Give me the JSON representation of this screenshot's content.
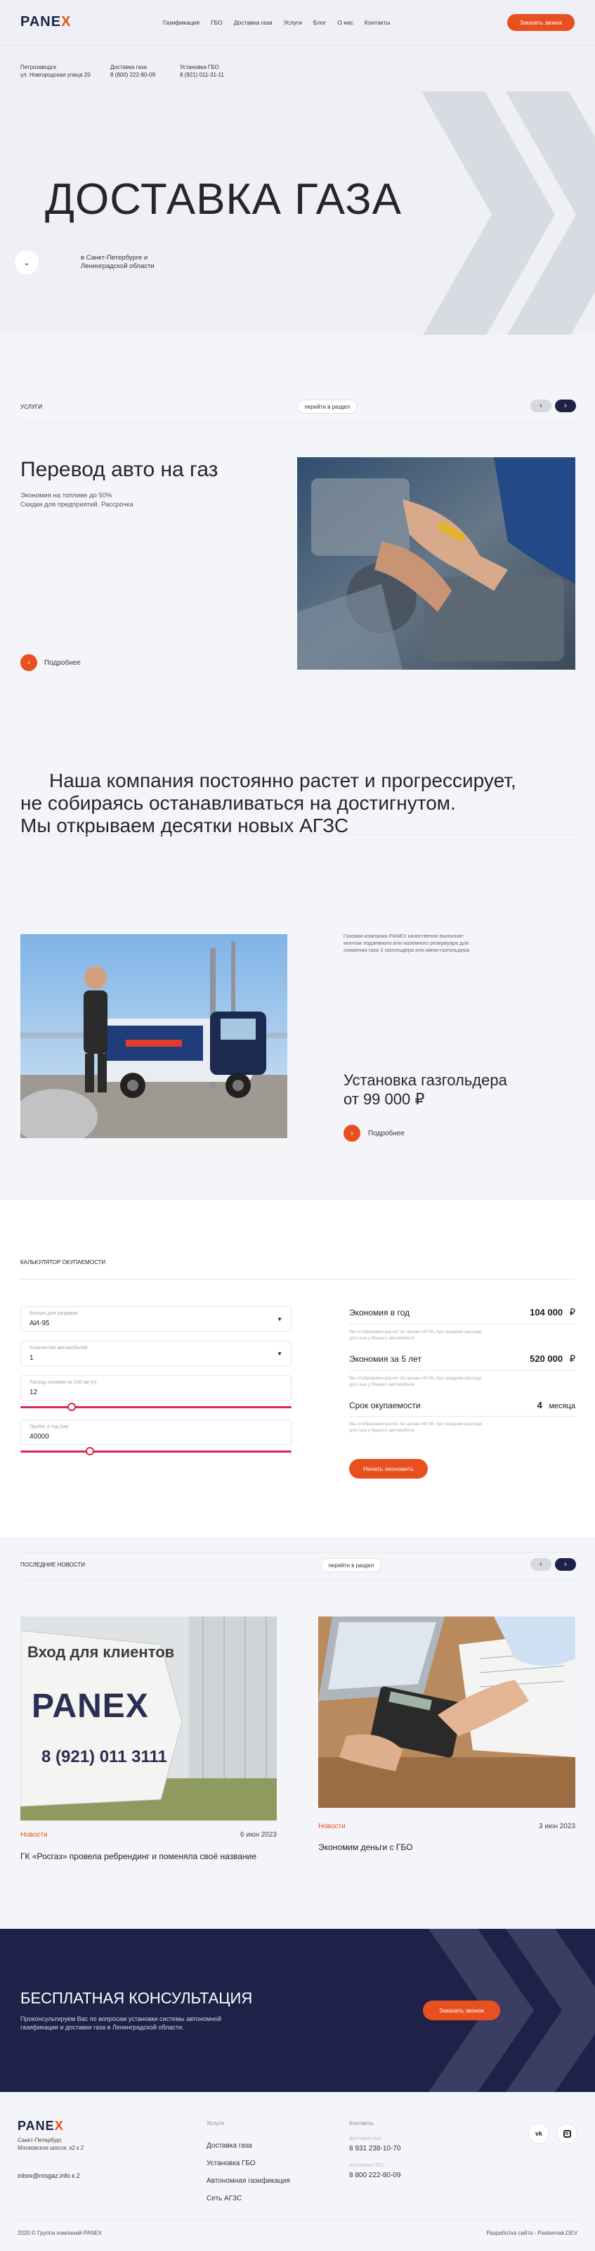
{
  "header": {
    "logo_left": "PANE",
    "logo_x": "X",
    "nav": [
      "Газификация",
      "ГБО",
      "Доставка газа",
      "Услуги",
      "Блог",
      "О нас",
      "Контакты"
    ],
    "cta": "Заказать звонок"
  },
  "hero": {
    "contacts": [
      {
        "line1": "Петрозаводск",
        "line2": "ул. Новгородская улица 20"
      },
      {
        "line1": "Доставка газа",
        "line2": "8 (800) 222-80-09"
      },
      {
        "line1": "Установка ГБО",
        "line2": "8 (921) 011-31-11"
      }
    ],
    "title": "ДОСТАВКА ГАЗА",
    "subtitle_line1": "в Санкт-Петербурге и",
    "subtitle_line2": "Ленинградской области"
  },
  "services": {
    "label": "УСЛУГИ",
    "link": "перейти в раздел",
    "title": "Перевод авто на газ",
    "desc_line1": "Экономия на топливе до 50%",
    "desc_line2": "Скидки для предприятий. Рассрочка",
    "more": "Подробнее"
  },
  "statement": {
    "line1": "Наша компания постоянно растет и прогрессирует,",
    "line2": "не собираясь останавливаться на достигнутом.",
    "line3": "Мы открываем десятки новых АГЗС"
  },
  "tank": {
    "desc": "Газовая компания PANEX качественно выполнит монтаж подземного или наземного резервуара для снижения газа 3 газгольдера или мини-газгольдера",
    "title_line1": "Установка газгольдера",
    "title_line2": "от 99 000 ₽",
    "more": "Подробнее"
  },
  "calculator": {
    "label": "КАЛЬКУЛЯТОР ОКУПАЕМОСТИ",
    "fields": [
      {
        "label": "Бензин для заправки",
        "value": "АИ-95",
        "type": "select"
      },
      {
        "label": "Количество автомобилей",
        "value": "1",
        "type": "select"
      },
      {
        "label": "Расход топлива на 100 км (л)",
        "value": "12",
        "type": "slider",
        "fill": 0.2
      },
      {
        "label": "Пробег в год (км)",
        "value": "40000",
        "type": "slider",
        "fill": 0.26
      }
    ],
    "results": [
      {
        "label": "Экономия в год",
        "value": "104 000",
        "unit": "₽",
        "note": "Мы отображаем расчет по ценам АИ 95, при среднем расходе для газа у Вашего автомобиля"
      },
      {
        "label": "Экономия за 5 лет",
        "value": "520 000",
        "unit": "₽",
        "note": "Мы отображаем расчет по ценам АИ 95, при среднем расходе для газа у Вашего автомобиля"
      },
      {
        "label": "Срок окупаемости",
        "value": "4",
        "unit": "месяца",
        "note": "Мы отображаем расчет по ценам АИ 95, при среднем расходе для газа у Вашего автомобиля"
      }
    ],
    "cta": "Начать экономить"
  },
  "news": {
    "label": "ПОСЛЕДНИЕ НОВОСТИ",
    "link": "перейти в раздел",
    "items": [
      {
        "tag": "Новости",
        "date": "6 июн 2023",
        "title": "ГК «Росгаз» провела ребрендинг и поменяла своё название",
        "sign_line1": "Вход для клиентов",
        "sign_phone": "8 (921) 011 3111",
        "sign_logo": "PANEX"
      },
      {
        "tag": "Новости",
        "date": "3 июн 2023",
        "title": "Экономим деньги с ГБО"
      }
    ]
  },
  "consult": {
    "title": "БЕСПЛАТНАЯ КОНСУЛЬТАЦИЯ",
    "desc_line1": "Проконсультируем Вас по вопросам установки системы автономной",
    "desc_line2": "газификации и доставки газа в Ленинградской области.",
    "cta": "Заказать звонок"
  },
  "footer": {
    "address_line1": "Санкт-Петербург,",
    "address_line2": "Московское шоссе, к2 к 2",
    "email": "inbox@rosgaz.info к 2",
    "services_label": "Услуги",
    "services": [
      "Доставка газа",
      "Установка ГБО",
      "Автономная газификация",
      "Сеть АГЗС"
    ],
    "contacts_label": "Контакты",
    "contact1_label": "Доставка газа",
    "contact1": "8 931 238-10-70",
    "contact2_label": "Установка ГБО",
    "contact2": "8 800 222-80-09",
    "copyright": "2020 © Группа компаний PANEX",
    "dev": "Разработка сайта - Paskernak.DEV",
    "social": [
      "vk",
      "instagram"
    ]
  },
  "colors": {
    "accent": "#e9501f",
    "navy": "#1e2248",
    "slider": "#d7264f"
  }
}
